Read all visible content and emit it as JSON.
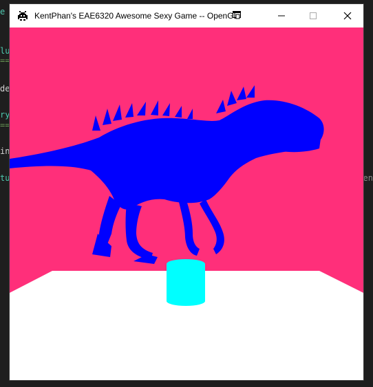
{
  "window": {
    "title": "KentPhan's EAE6320 Awesome Sexy Game -- OpenGL",
    "controls": {
      "minimize": "minimize",
      "maximize": "maximize",
      "close": "close"
    }
  },
  "background_editor": {
    "fragments": [
      {
        "text": "e",
        "color": "#4ec9b0"
      },
      {
        "text": "lu",
        "color": "#4ec9b0"
      },
      {
        "text": "==",
        "color": "#6a9955"
      },
      {
        "text": "de",
        "color": "#d4d4d4"
      },
      {
        "text": "ry",
        "color": "#4ec9b0"
      },
      {
        "text": "==",
        "color": "#6a9955"
      },
      {
        "text": "in",
        "color": "#d4d4d4"
      },
      {
        "text": "tu",
        "color": "#4ec9b0"
      }
    ],
    "right_fragment": "en"
  },
  "scene": {
    "colors": {
      "back_wall": "#ff2f7a",
      "floor": "#ffffff",
      "dinosaur": "#0000ff",
      "cylinder": "#00ffff"
    },
    "objects": [
      "back-wall",
      "floor",
      "dinosaur",
      "cylinder"
    ]
  }
}
